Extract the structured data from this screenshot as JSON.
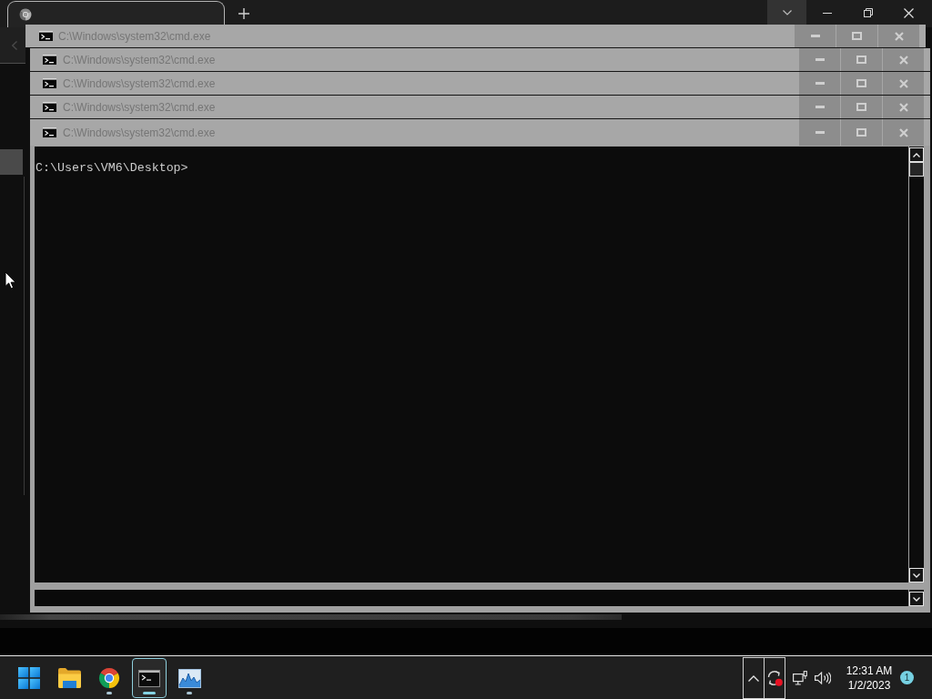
{
  "cmd_windows": [
    {
      "title": "C:\\Windows\\system32\\cmd.exe"
    },
    {
      "title": "C:\\Windows\\system32\\cmd.exe"
    },
    {
      "title": "C:\\Windows\\system32\\cmd.exe"
    },
    {
      "title": "C:\\Windows\\system32\\cmd.exe"
    },
    {
      "title": "C:\\Windows\\system32\\cmd.exe"
    }
  ],
  "console": {
    "lines": [
      "C:\\Users\\VM6\\Desktop>"
    ]
  },
  "taskbar": {
    "apps": [
      {
        "kind": "start",
        "running": false,
        "selected": false
      },
      {
        "kind": "explorer",
        "running": false,
        "selected": false
      },
      {
        "kind": "browser",
        "running": true,
        "selected": false
      },
      {
        "kind": "terminal",
        "running": true,
        "selected": true
      },
      {
        "kind": "monitor",
        "running": true,
        "selected": false
      }
    ],
    "tray": {
      "time": "12:31 AM",
      "date": "1/2/2023",
      "notifications": "1"
    }
  }
}
